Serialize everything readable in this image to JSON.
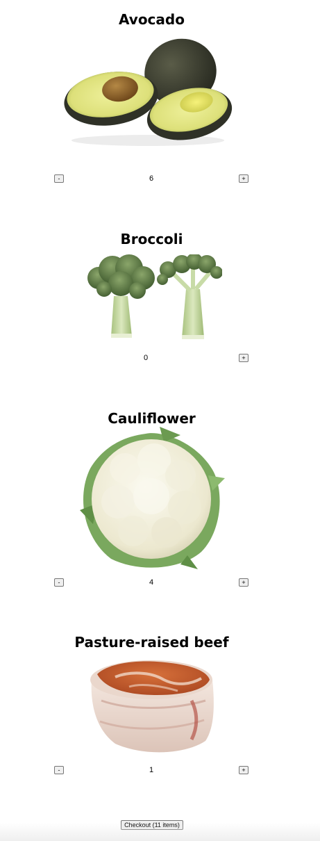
{
  "products": [
    {
      "name": "Avocado",
      "image_icon": "avocado-image",
      "quantity": "6",
      "minus_label": "-",
      "plus_label": "+",
      "show_minus": true
    },
    {
      "name": "Broccoli",
      "image_icon": "broccoli-image",
      "quantity": "0",
      "minus_label": "-",
      "plus_label": "+",
      "show_minus": false
    },
    {
      "name": "Cauliflower",
      "image_icon": "cauliflower-image",
      "quantity": "4",
      "minus_label": "-",
      "plus_label": "+",
      "show_minus": true
    },
    {
      "name": "Pasture-raised beef",
      "image_icon": "beef-image",
      "quantity": "1",
      "minus_label": "-",
      "plus_label": "+",
      "show_minus": true
    }
  ],
  "checkout": {
    "label": "Checkout (11 items)"
  },
  "colors": {
    "avocado_skin": "#3a3d30",
    "avocado_flesh": "#e6e58a",
    "avocado_pit": "#8a6228",
    "broccoli_head": "#5d7a45",
    "broccoli_stem": "#c6d9a3",
    "cauliflower_curd": "#f2f0e2",
    "cauliflower_leaf": "#7aa85e",
    "beef_meat": "#c45a2c",
    "beef_fat": "#f1e4dc"
  }
}
